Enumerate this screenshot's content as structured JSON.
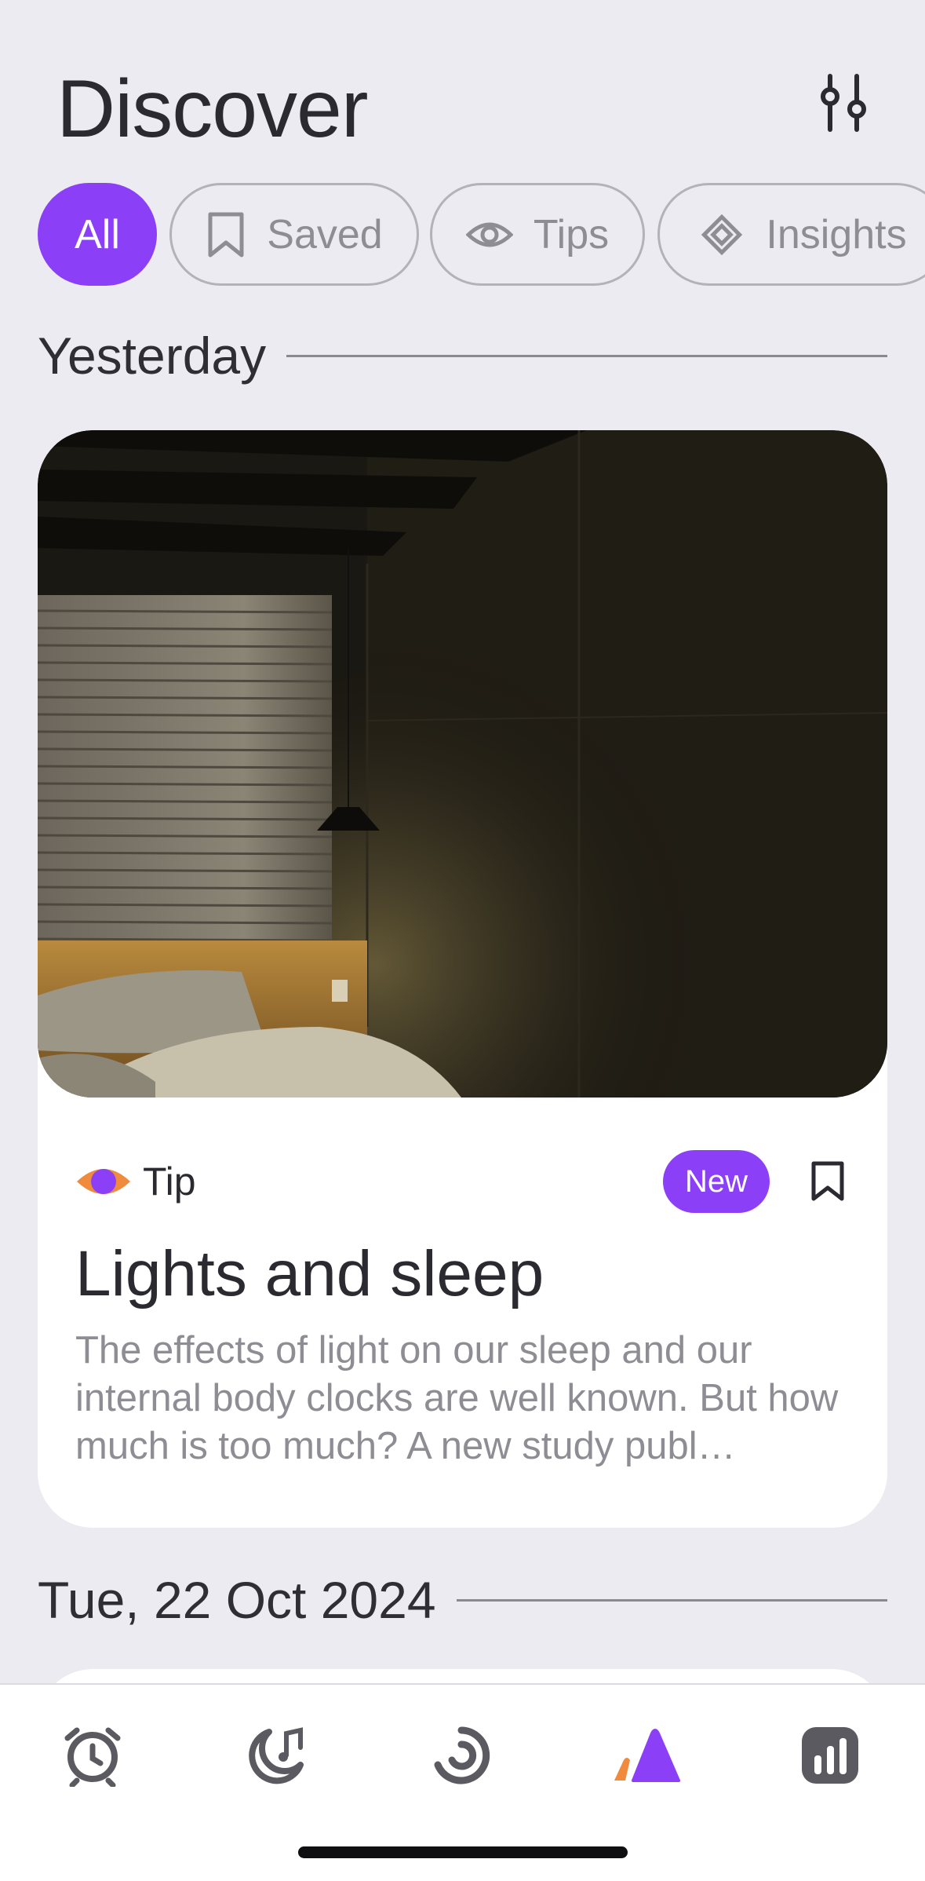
{
  "header": {
    "title": "Discover",
    "filter_icon": "sliders-icon"
  },
  "filters": [
    {
      "label": "All",
      "icon": "",
      "active": true
    },
    {
      "label": "Saved",
      "icon": "bookmark-icon",
      "active": false
    },
    {
      "label": "Tips",
      "icon": "eye-icon",
      "active": false
    },
    {
      "label": "Insights",
      "icon": "diamond-icon",
      "active": false
    }
  ],
  "sections": [
    {
      "title": "Yesterday"
    },
    {
      "title": "Tue, 22 Oct 2024"
    }
  ],
  "card": {
    "type_label": "Tip",
    "type_icon": "eye-icon",
    "badge": "New",
    "title": "Lights and sleep",
    "body": "The effects of light on our sleep and our internal body clocks are well known. But how much is too much? A new study publ…"
  },
  "tabbar": {
    "items": [
      {
        "name": "alarm-clock-icon"
      },
      {
        "name": "moon-music-icon"
      },
      {
        "name": "progress-ring-icon"
      },
      {
        "name": "discover-icon",
        "active": true
      },
      {
        "name": "stats-icon"
      }
    ]
  },
  "colors": {
    "accent": "#8b3ff6",
    "orange": "#f08a3c",
    "background": "#ecebf1"
  }
}
